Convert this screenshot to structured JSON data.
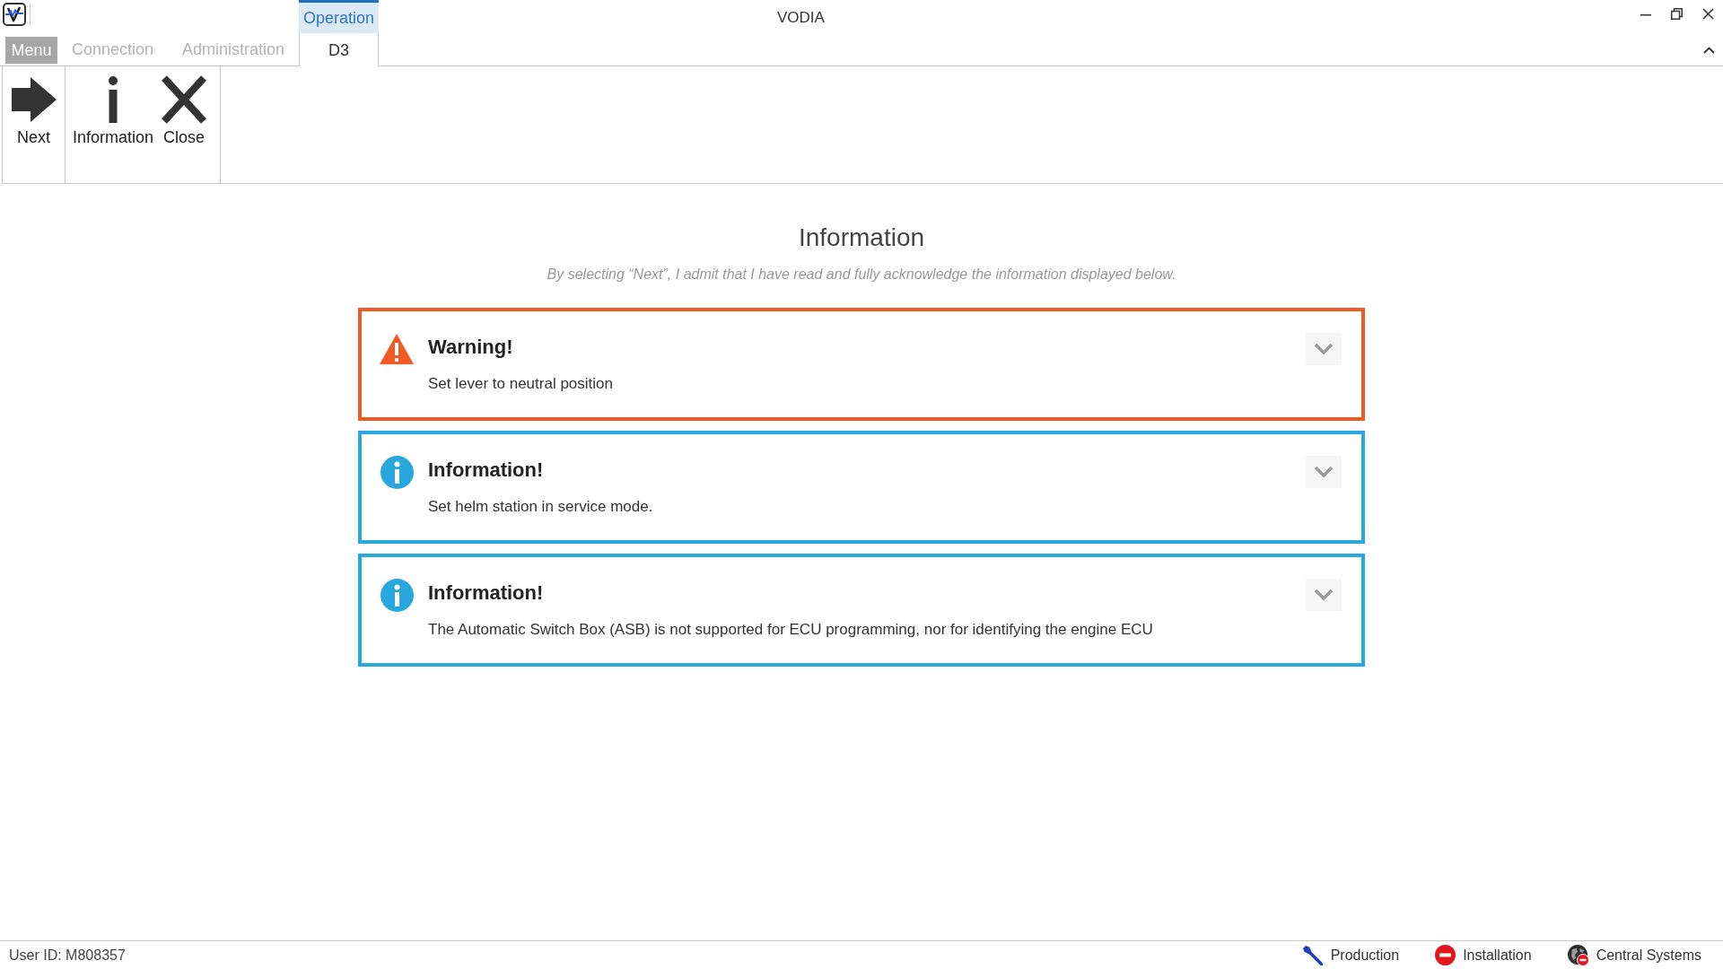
{
  "window": {
    "title": "VODIA"
  },
  "ribbon": {
    "context_group": "Operation",
    "tabs": [
      {
        "label": "Menu",
        "kind": "menu",
        "selected": false,
        "disabled": false
      },
      {
        "label": "Connection",
        "kind": "tab",
        "selected": false,
        "disabled": true
      },
      {
        "label": "Administration",
        "kind": "tab",
        "selected": false,
        "disabled": true
      },
      {
        "label": "D3",
        "kind": "tab",
        "selected": true,
        "disabled": false
      }
    ],
    "groups": [
      {
        "buttons": [
          {
            "label": "Next",
            "kind": "next"
          }
        ]
      },
      {
        "buttons": [
          {
            "label": "Information",
            "kind": "information"
          },
          {
            "label": "Close",
            "kind": "close"
          }
        ]
      }
    ]
  },
  "page": {
    "heading": "Information",
    "subtitle": "By selecting “Next”, I admit that I have read and fully acknowledge the information displayed below.",
    "notices": [
      {
        "kind": "warning",
        "title": "Warning!",
        "message": "Set lever to neutral position",
        "expanded": false
      },
      {
        "kind": "information",
        "title": "Information!",
        "message": "Set helm station in service mode.",
        "expanded": false
      },
      {
        "kind": "information",
        "title": "Information!",
        "message": "The Automatic Switch Box (ASB) is not supported for ECU programming, nor for identifying the engine ECU",
        "expanded": false
      }
    ]
  },
  "status_bar": {
    "user_id": "User ID: M808357",
    "indicators": [
      {
        "label": "Production"
      },
      {
        "label": "Installation"
      },
      {
        "label": "Central Systems"
      }
    ]
  }
}
